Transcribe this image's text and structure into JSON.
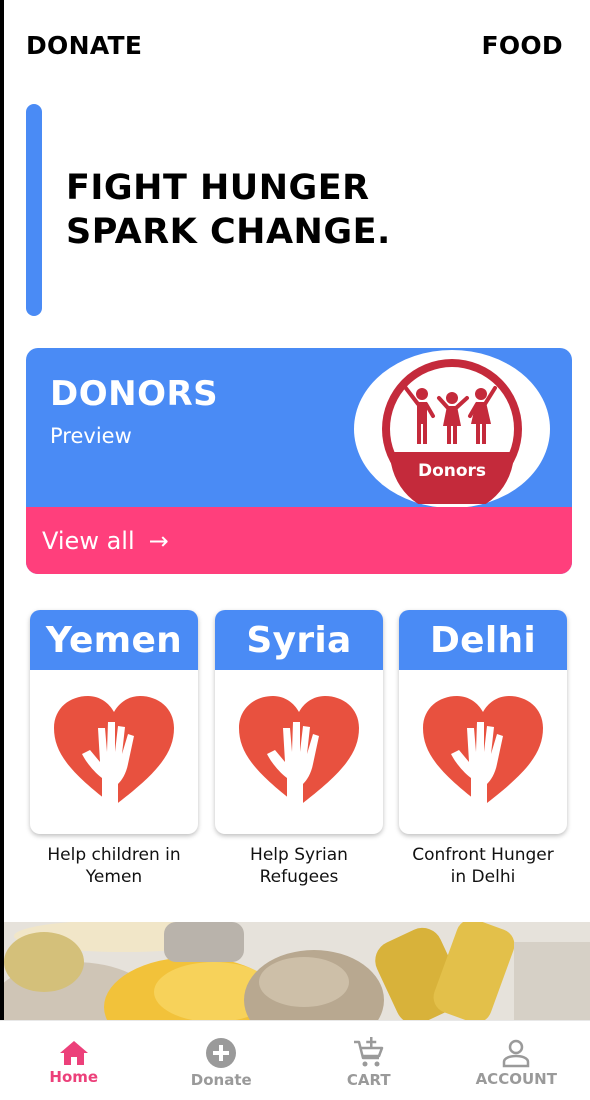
{
  "header": {
    "left": "DONATE",
    "right": "FOOD"
  },
  "hero": {
    "line1": "FIGHT HUNGER",
    "line2": "SPARK CHANGE."
  },
  "donors": {
    "title": "DONORS",
    "subtitle": "Preview",
    "badge_text": "Donors",
    "view_all": "View all"
  },
  "campaigns": [
    {
      "title": "Yemen",
      "caption_1": "Help children in",
      "caption_2": "Yemen"
    },
    {
      "title": "Syria",
      "caption_1": "Help Syrian",
      "caption_2": "Refugees"
    },
    {
      "title": "Delhi",
      "caption_1": "Confront Hunger",
      "caption_2": "in Delhi"
    }
  ],
  "nav": [
    {
      "label": "Home",
      "icon": "home-icon",
      "active": true
    },
    {
      "label": "Donate",
      "icon": "add-circle-icon",
      "active": false
    },
    {
      "label": "CART",
      "icon": "cart-add-icon",
      "active": false
    },
    {
      "label": "ACCOUNT",
      "icon": "account-icon",
      "active": false
    }
  ],
  "colors": {
    "blue": "#4a8bf5",
    "pink": "#ff3f7c",
    "heart": "#e8513f",
    "badge": "#c42a3b",
    "nav_active": "#ec407a"
  }
}
